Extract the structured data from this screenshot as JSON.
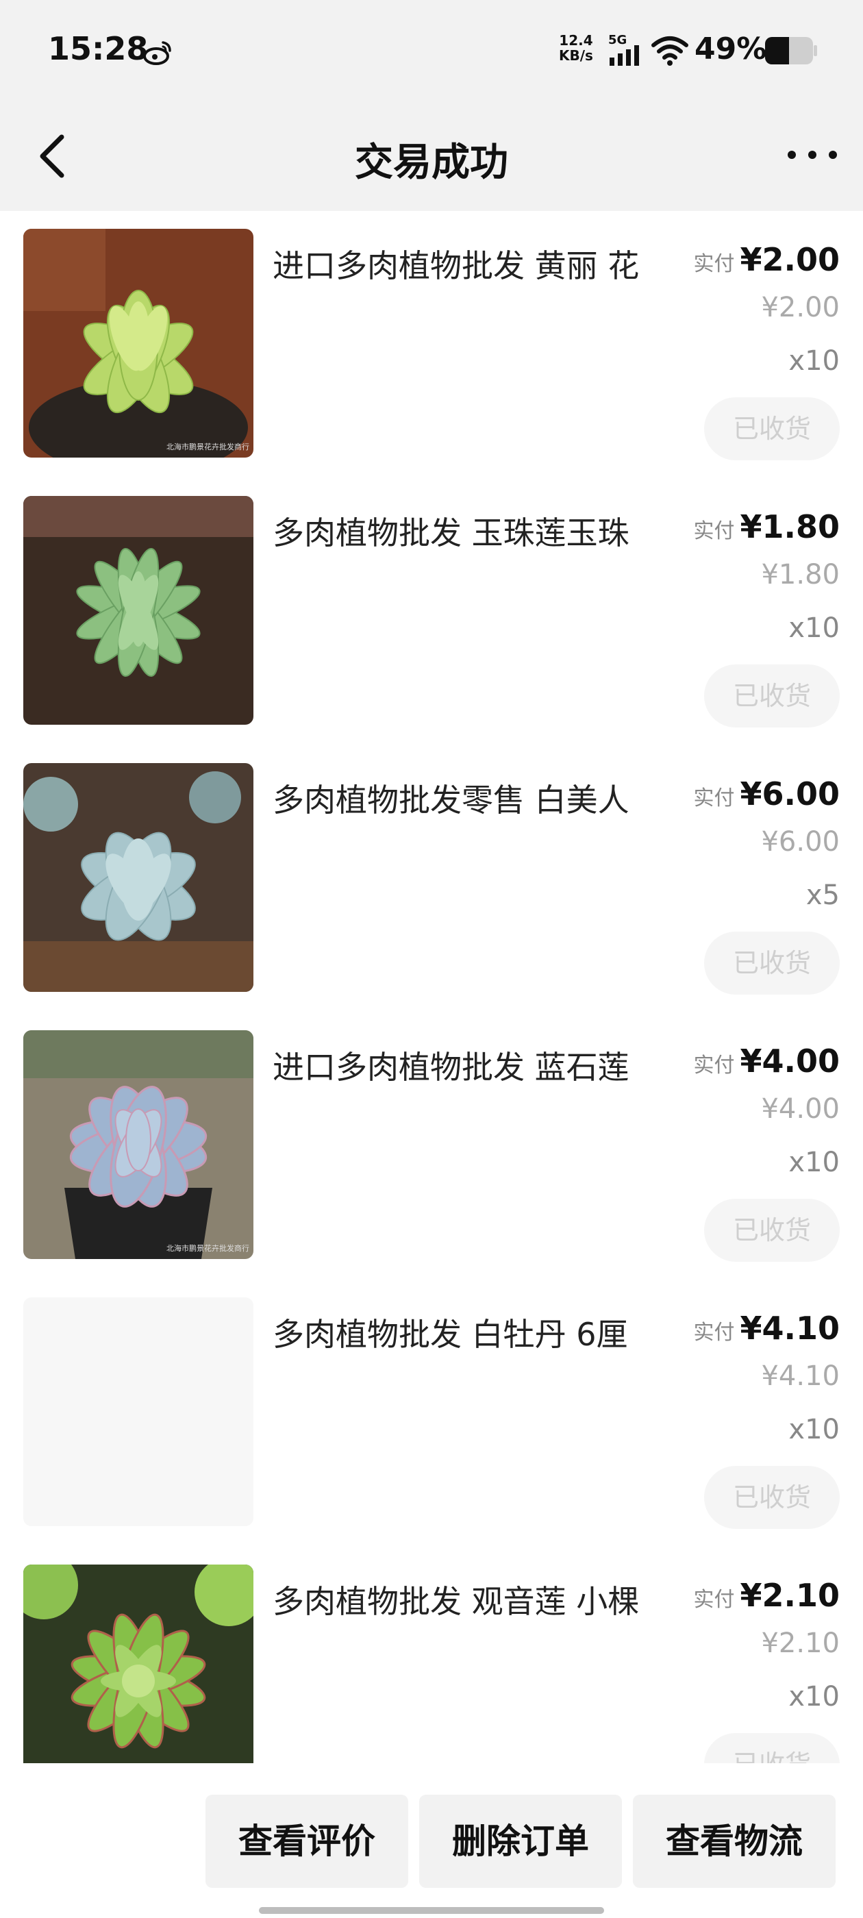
{
  "status_bar": {
    "time": "15:28",
    "net_speed_value": "12.4",
    "net_speed_unit": "KB/s",
    "network_type": "5G",
    "battery": "49%",
    "icons": [
      "weibo-icon",
      "signal-icon",
      "wifi-icon",
      "battery-icon"
    ]
  },
  "header": {
    "title": "交易成功",
    "back_icon": "chevron-left-icon",
    "more_icon": "more-horizontal-icon"
  },
  "items": [
    {
      "title": "进口多肉植物批发 黄丽 花",
      "paid_label": "实付",
      "paid": "¥2.00",
      "original": "¥2.00",
      "qty": "x10",
      "action": "已收货",
      "image": "succulent-yellow-green",
      "watermark": "北海市鹏景花卉批发商行"
    },
    {
      "title": "多肉植物批发 玉珠莲玉珠",
      "paid_label": "实付",
      "paid": "¥1.80",
      "original": "¥1.80",
      "qty": "x10",
      "action": "已收货",
      "image": "succulent-green-rosette"
    },
    {
      "title": "多肉植物批发零售 白美人",
      "paid_label": "实付",
      "paid": "¥6.00",
      "original": "¥6.00",
      "qty": "x5",
      "action": "已收货",
      "image": "succulent-pale-blue"
    },
    {
      "title": "进口多肉植物批发 蓝石莲",
      "paid_label": "实付",
      "paid": "¥4.00",
      "original": "¥4.00",
      "qty": "x10",
      "action": "已收货",
      "image": "succulent-blue-echeveria",
      "watermark": "北海市鹏景花卉批发商行"
    },
    {
      "title": "多肉植物批发 白牡丹 6厘",
      "paid_label": "实付",
      "paid": "¥4.10",
      "original": "¥4.10",
      "qty": "x10",
      "action": "已收货",
      "image": "blank"
    },
    {
      "title": "多肉植物批发 观音莲 小棵",
      "paid_label": "实付",
      "paid": "¥2.10",
      "original": "¥2.10",
      "qty": "x10",
      "action": "已收货",
      "image": "succulent-green-red-tips"
    }
  ],
  "bottom_actions": {
    "view_review": "查看评价",
    "delete_order": "删除订单",
    "view_logistics": "查看物流"
  },
  "colors": {
    "background": "#ffffff",
    "header_bg": "#f2f2f2",
    "text_primary": "#111111",
    "text_secondary": "#888888",
    "text_muted": "#aaaaaa",
    "button_disabled_bg": "#f5f5f5",
    "button_disabled_text": "#cfcfcf"
  }
}
